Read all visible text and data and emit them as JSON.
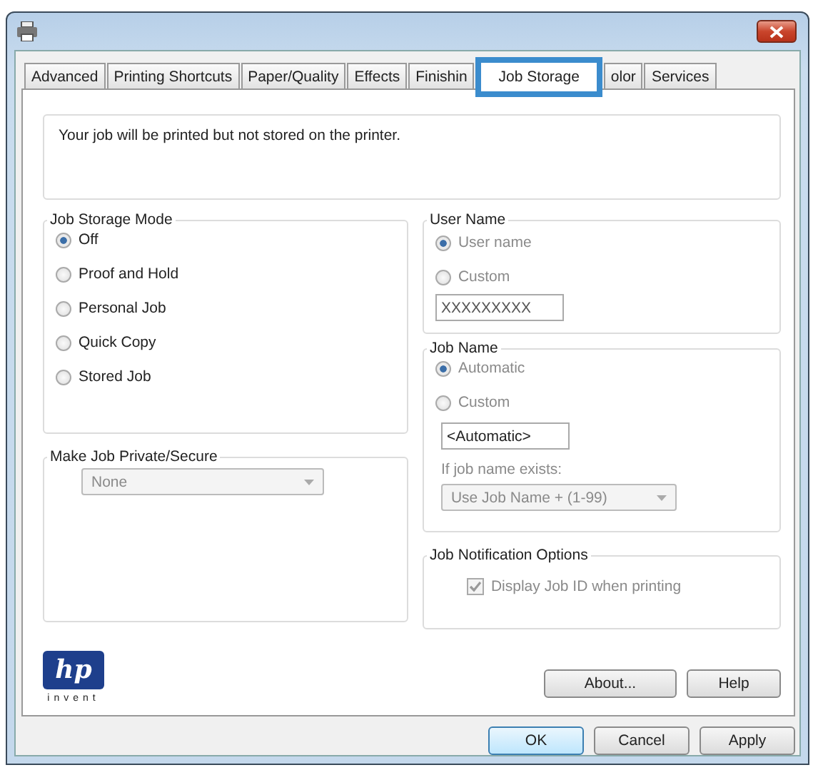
{
  "tabs": [
    {
      "label": "Advanced",
      "selected": false
    },
    {
      "label": "Printing Shortcuts",
      "selected": false
    },
    {
      "label": "Paper/Quality",
      "selected": false
    },
    {
      "label": "Effects",
      "selected": false
    },
    {
      "label": "Finishin",
      "selected": false
    },
    {
      "label": "Job Storage",
      "selected": true
    },
    {
      "label": "olor",
      "selected": false
    },
    {
      "label": "Services",
      "selected": false
    }
  ],
  "message": "Your job will be printed but not stored on the printer.",
  "job_storage_mode": {
    "title": "Job Storage Mode",
    "options": [
      {
        "label": "Off",
        "selected": true
      },
      {
        "label": "Proof and Hold",
        "selected": false
      },
      {
        "label": "Personal Job",
        "selected": false
      },
      {
        "label": "Quick Copy",
        "selected": false
      },
      {
        "label": "Stored Job",
        "selected": false
      }
    ]
  },
  "make_private": {
    "title": "Make Job Private/Secure",
    "value": "None",
    "disabled": true
  },
  "user_name": {
    "title": "User Name",
    "disabled": true,
    "options": [
      {
        "label": "User name",
        "selected": true
      },
      {
        "label": "Custom",
        "selected": false
      }
    ],
    "value": "XXXXXXXXX"
  },
  "job_name": {
    "title": "Job Name",
    "disabled": true,
    "options": [
      {
        "label": "Automatic",
        "selected": true
      },
      {
        "label": "Custom",
        "selected": false
      }
    ],
    "value": "<Automatic>",
    "exists_label": "If job name exists:",
    "exists_value": "Use Job Name + (1-99)"
  },
  "notification": {
    "title": "Job Notification Options",
    "checkbox": {
      "label": "Display Job ID when printing",
      "checked": true,
      "disabled": true
    }
  },
  "logo": {
    "mark": "hp",
    "tagline": "invent"
  },
  "panel_buttons": [
    "About...",
    "Help"
  ],
  "dialog_buttons": [
    {
      "label": "OK",
      "default": true
    },
    {
      "label": "Cancel",
      "default": false
    },
    {
      "label": "Apply",
      "default": false
    }
  ]
}
